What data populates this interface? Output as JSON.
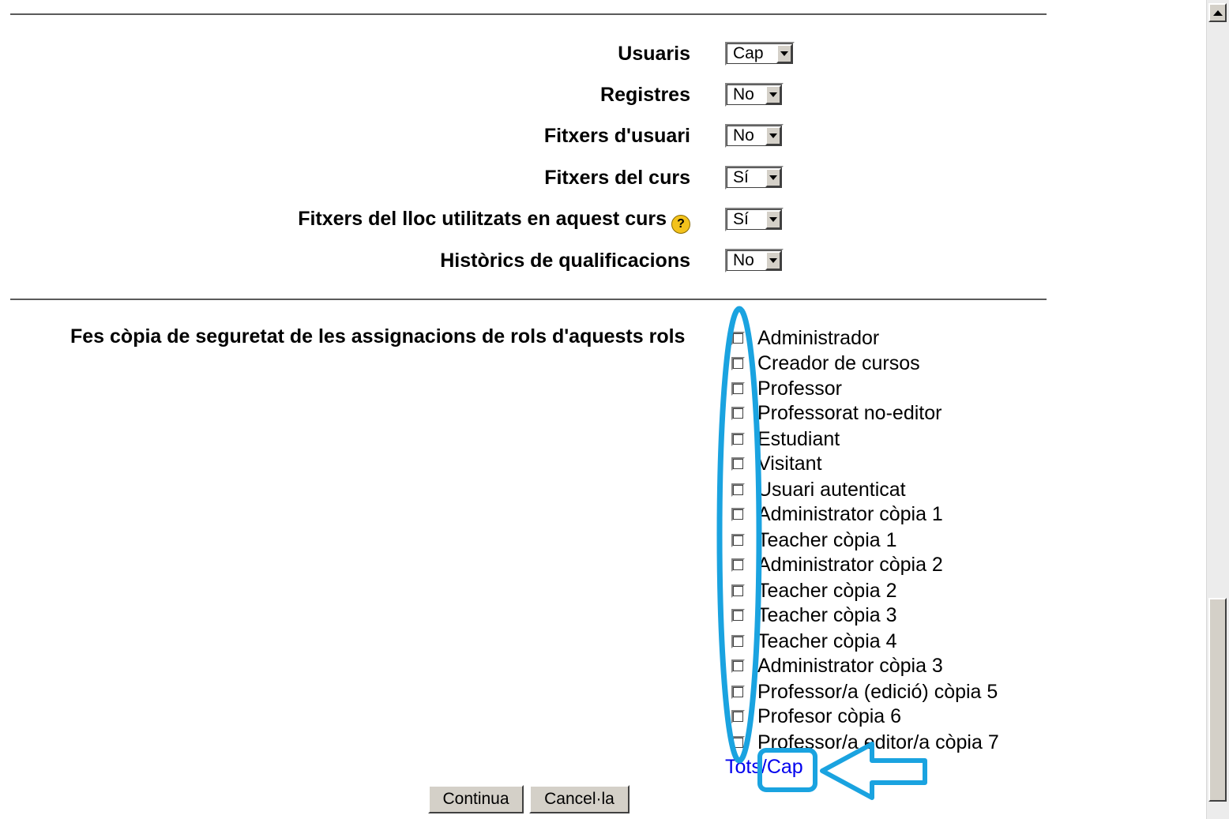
{
  "settings": [
    {
      "label": "Usuaris",
      "value": "Cap"
    },
    {
      "label": "Registres",
      "value": "No"
    },
    {
      "label": "Fitxers d'usuari",
      "value": "No"
    },
    {
      "label": "Fitxers del curs",
      "value": "Sí"
    },
    {
      "label": "Fitxers del lloc utilitzats en aquest curs",
      "value": "Sí"
    },
    {
      "label": "Històrics de qualificacions",
      "value": "No"
    }
  ],
  "help_icon": "help-icon",
  "roles": {
    "label": "Fes còpia de seguretat de les assignacions de rols d'aquests rols",
    "items": [
      "Administrador",
      "Creador de cursos",
      "Professor",
      "Professorat no-editor",
      "Estudiant",
      "Visitant",
      "Usuari autenticat",
      "Administrator còpia 1",
      "Teacher còpia 1",
      "Administrator còpia 2",
      "Teacher còpia 2",
      "Teacher còpia 3",
      "Teacher còpia 4",
      "Administrator còpia 3",
      "Professor/a (edició) còpia 5",
      "Profesor còpia 6",
      "Professor/a editor/a còpia 7"
    ],
    "select_all": "Tots",
    "separator": "/",
    "select_none": "Cap"
  },
  "buttons": {
    "continue": "Continua",
    "cancel": "Cancel·la"
  },
  "colors": {
    "annotation": "#1aa3e0",
    "link": "#0000ee"
  }
}
